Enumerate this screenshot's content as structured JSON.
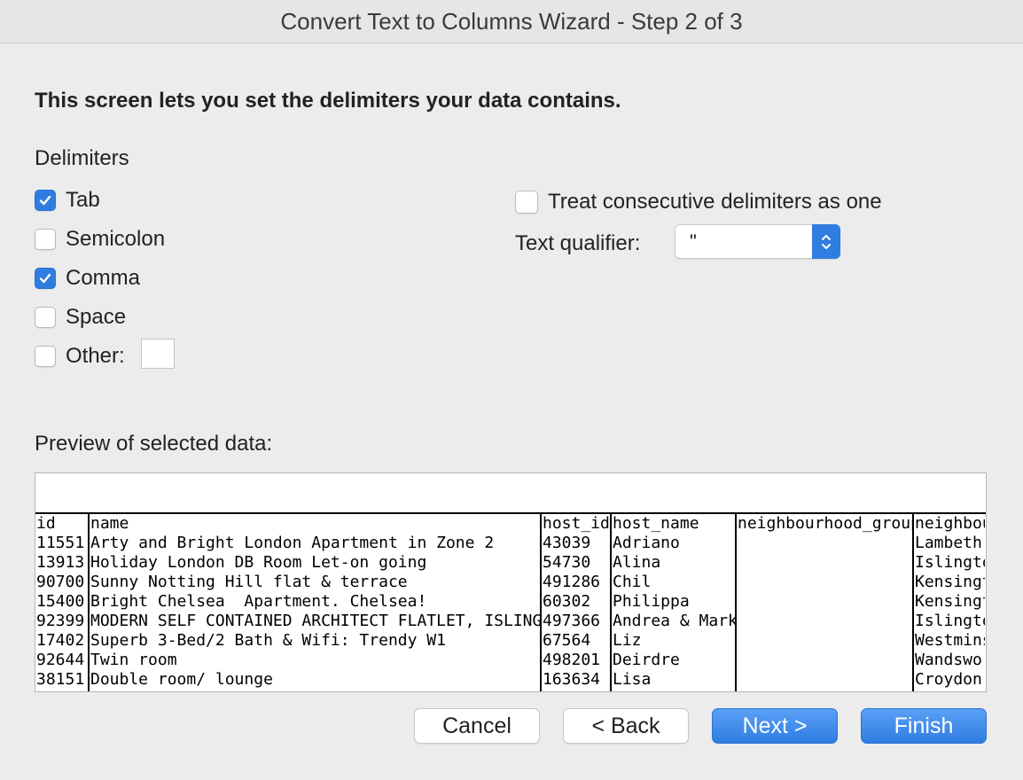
{
  "window": {
    "title": "Convert Text to Columns Wizard - Step 2 of 3"
  },
  "heading": "This screen lets you set the delimiters your data contains.",
  "delimiters": {
    "label": "Delimiters",
    "tab": {
      "label": "Tab",
      "checked": true
    },
    "semicolon": {
      "label": "Semicolon",
      "checked": false
    },
    "comma": {
      "label": "Comma",
      "checked": true
    },
    "space": {
      "label": "Space",
      "checked": false
    },
    "other": {
      "label": "Other:",
      "checked": false,
      "value": ""
    }
  },
  "consecutive": {
    "label": "Treat consecutive delimiters as one",
    "checked": false
  },
  "qualifier": {
    "label": "Text qualifier:",
    "value": "\""
  },
  "preview": {
    "label": "Preview of selected data:",
    "columns": [
      {
        "key": "id",
        "cells": [
          "id",
          "11551",
          "13913",
          "90700",
          "15400",
          "92399",
          "17402",
          "92644",
          "38151"
        ]
      },
      {
        "key": "name",
        "cells": [
          "name",
          "Arty and Bright London Apartment in Zone 2",
          "Holiday London DB Room Let-on going",
          "Sunny Notting Hill flat & terrace",
          "Bright Chelsea  Apartment. Chelsea!",
          "MODERN SELF CONTAINED ARCHITECT FLATLET, ISLINGTON",
          "Superb 3-Bed/2 Bath & Wifi: Trendy W1",
          "Twin room",
          "Double room/ lounge"
        ]
      },
      {
        "key": "host_id",
        "cells": [
          "host_id",
          "43039",
          "54730",
          "491286",
          "60302",
          "497366",
          "67564",
          "498201",
          "163634"
        ]
      },
      {
        "key": "host_name",
        "cells": [
          "host_name",
          "Adriano",
          "Alina",
          "Chil",
          "Philippa",
          "Andrea & Mark",
          "Liz",
          "Deirdre",
          "Lisa"
        ]
      },
      {
        "key": "neighbourhood_group",
        "cells": [
          "neighbourhood_group",
          "",
          "",
          "",
          "",
          "",
          "",
          "",
          ""
        ]
      },
      {
        "key": "neighbourhood",
        "cells": [
          "neighbou",
          "Lambeth",
          "Islingto",
          "Kensingt",
          "Kensingt",
          "Islingto",
          "Westmins",
          "Wandswor",
          "Croydon"
        ]
      }
    ]
  },
  "buttons": {
    "cancel": "Cancel",
    "back": "< Back",
    "next": "Next >",
    "finish": "Finish"
  },
  "colors": {
    "accent": "#2f7de1",
    "window_bg": "#ececec"
  }
}
